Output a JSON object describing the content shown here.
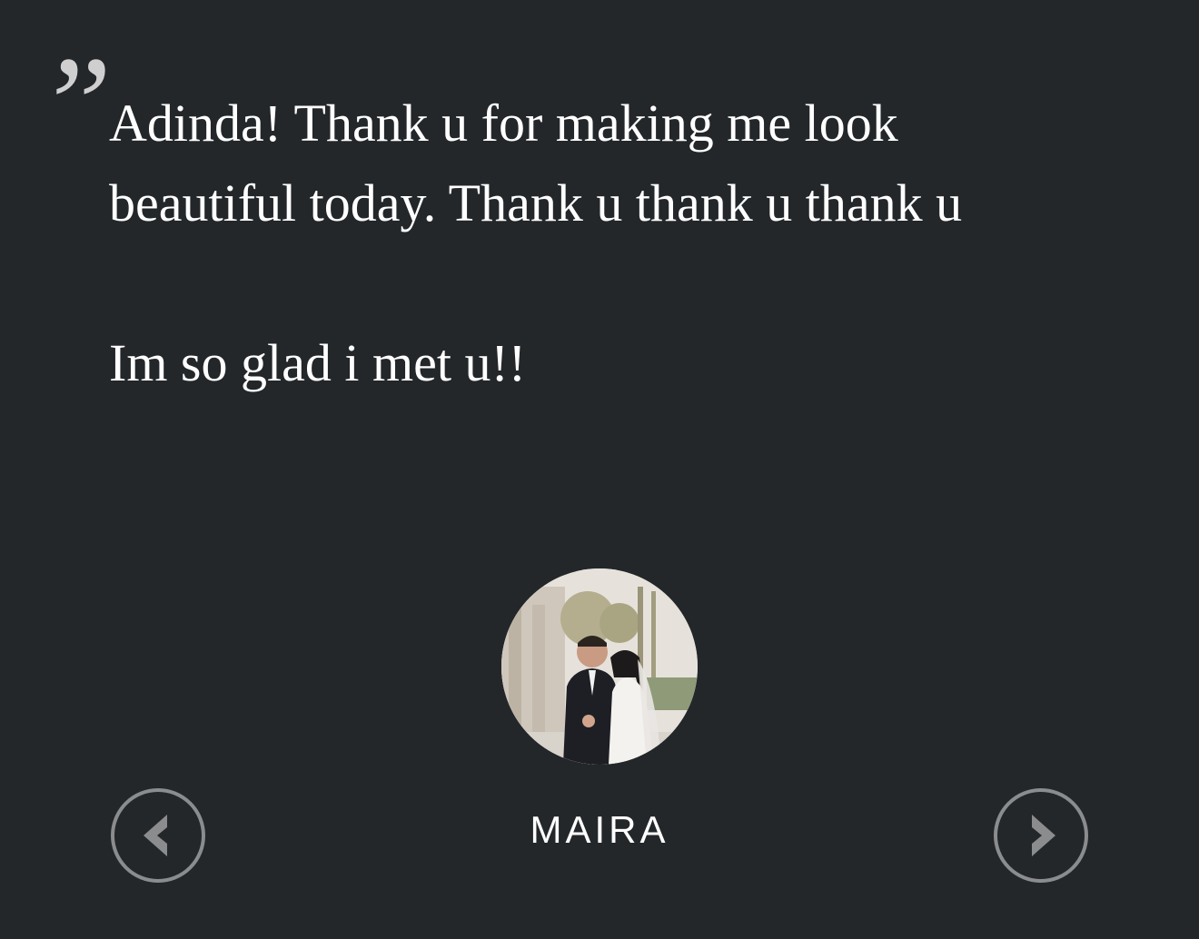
{
  "testimonial": {
    "quote_mark": "”",
    "lines": [
      "Adinda! Thank u for making me look",
      "beautiful today. Thank u thank u thank u",
      "Im so glad i met u!!"
    ],
    "author": "MAIRA"
  },
  "nav": {
    "prev_icon": "chevron-left-icon",
    "next_icon": "chevron-right-icon"
  },
  "colors": {
    "background": "#23272a",
    "text": "#ffffff",
    "quote_mark": "#cfcfcf",
    "nav_ring": "#8a8c8e"
  }
}
